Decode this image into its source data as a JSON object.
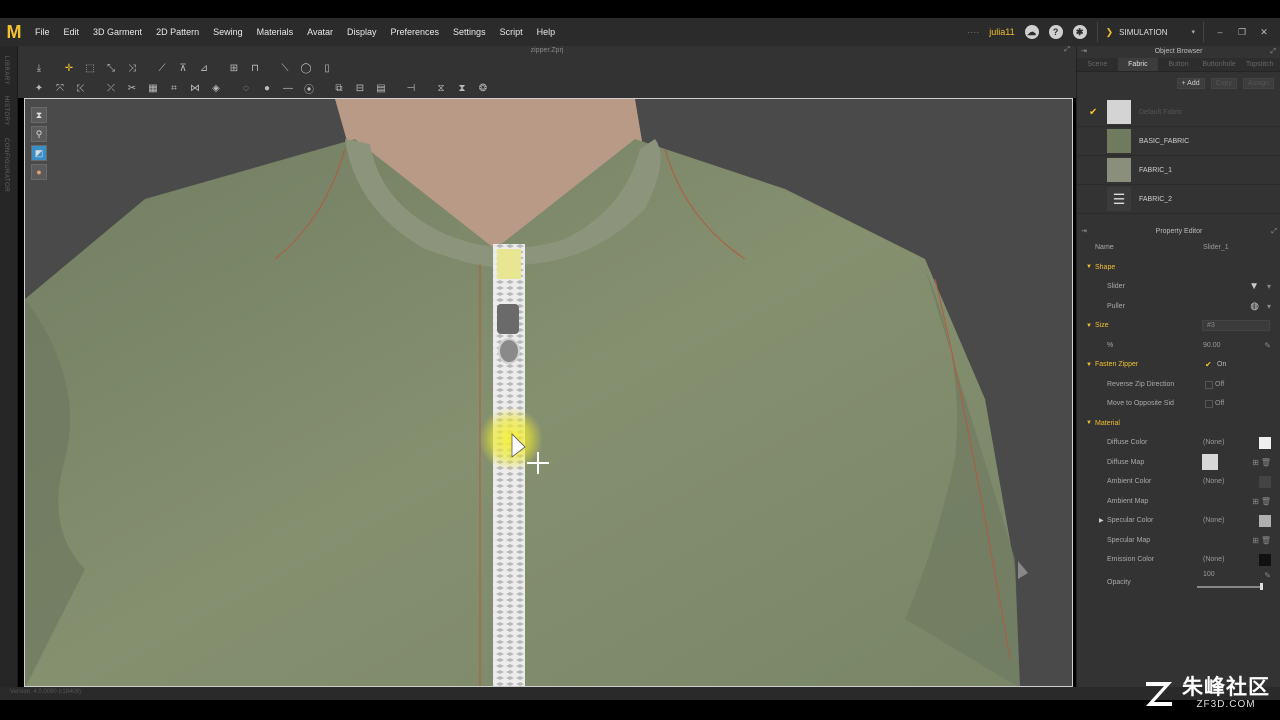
{
  "menu": {
    "items": [
      "File",
      "Edit",
      "3D Garment",
      "2D Pattern",
      "Sewing",
      "Materials",
      "Avatar",
      "Display",
      "Preferences",
      "Settings",
      "Script",
      "Help"
    ],
    "logo_letter": "M",
    "user_prefix": "····",
    "user": "julia11",
    "mode": "SIMULATION"
  },
  "left_tabs": [
    "LIBRARY",
    "HISTORY",
    "CONFIGURATOR"
  ],
  "viewport": {
    "file_title": "zipper.Zprj"
  },
  "object_browser": {
    "title": "Object Browser",
    "tabs": [
      "Scene",
      "Fabric",
      "Button",
      "Buttonhole",
      "Topstitch"
    ],
    "active_tab": "Fabric",
    "actions": {
      "add": "+ Add",
      "copy": "Copy",
      "assign": "Assign"
    },
    "fabrics": [
      {
        "name": "Default Fabric",
        "checked": true,
        "color": "#d4d4d4",
        "dim": true
      },
      {
        "name": "BASIC_FABRIC",
        "checked": false,
        "color": "#6f7a5e",
        "dim": false
      },
      {
        "name": "FABRIC_1",
        "checked": false,
        "color": "#8a8f7c",
        "dim": false
      },
      {
        "name": "FABRIC_2",
        "checked": false,
        "color": "#3b3b3b",
        "dim": false
      }
    ]
  },
  "property_editor": {
    "title": "Property Editor",
    "name_label": "Name",
    "name_value": "Slider_1",
    "shape": {
      "title": "Shape",
      "slider_label": "Slider",
      "puller_label": "Puller"
    },
    "size": {
      "title": "Size",
      "dropdown": "#3",
      "percent_label": "%",
      "percent_value": "90.00"
    },
    "fasten": {
      "title": "Fasten Zipper",
      "value": "On",
      "reverse_label": "Reverse Zip Direction",
      "reverse_value": "Off",
      "move_label": "Move to Opposite Sid",
      "move_value": "Off"
    },
    "material": {
      "title": "Material",
      "diffuse_color_label": "Diffuse Color",
      "diffuse_color_value": "(None)",
      "diffuse_map_label": "Diffuse Map",
      "ambient_color_label": "Ambient Color",
      "ambient_color_value": "(None)",
      "ambient_map_label": "Ambient Map",
      "specular_color_label": "Specular Color",
      "specular_color_value": "(None)",
      "specular_map_label": "Specular Map",
      "emission_color_label": "Emission Color",
      "emission_color_value": "(None)",
      "opacity_label": "Opacity",
      "opacity_value": "100"
    }
  },
  "status": "Version: 4.0.0080    (r18409)",
  "watermark": {
    "cn": "朱峰社区",
    "en": "ZF3D.COM"
  },
  "colors": {
    "accent": "#f0c030",
    "garment": "#7f8a6c",
    "collar": "#8a9278",
    "zipper": "#e6e6e6",
    "highlight": "#f4ee30"
  }
}
